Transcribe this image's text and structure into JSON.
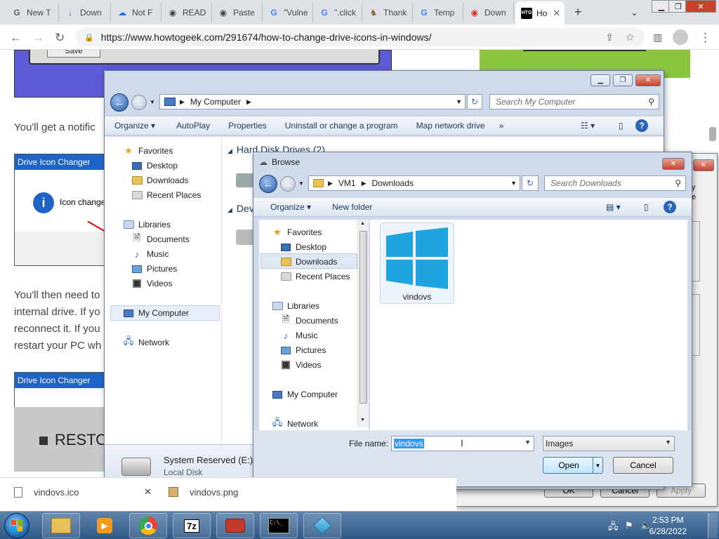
{
  "browser": {
    "tabs": [
      {
        "title": "New T",
        "icon": "G"
      },
      {
        "title": "Down",
        "icon": "↓"
      },
      {
        "title": "Not F",
        "icon": "☁"
      },
      {
        "title": "READ",
        "icon": "◉"
      },
      {
        "title": "Paste",
        "icon": "◉"
      },
      {
        "title": "\"Vulne",
        "icon": "G"
      },
      {
        "title": "\".click",
        "icon": "G"
      },
      {
        "title": "Thank",
        "icon": "♞"
      },
      {
        "title": "Temp",
        "icon": "G"
      },
      {
        "title": "Down",
        "icon": "◉"
      },
      {
        "title": "Ho",
        "icon": "HTG"
      }
    ],
    "new_tab_symbol": "+",
    "url": "https://www.howtogeek.com/291674/how-to-change-drive-icons-in-windows/"
  },
  "page": {
    "save_label": "Save",
    "para1": "You'll get a notific",
    "para2_lines": [
      "You'll then need to",
      "internal drive. If yo",
      "reconnect it. If you",
      "restart your PC wh"
    ],
    "dialog1_title": "Drive Icon Changer",
    "dialog1_text": "Icon change",
    "dialog2_title": "Drive Icon Changer",
    "restore_label": "RESTOR"
  },
  "explorer": {
    "location": "My Computer",
    "search_placeholder": "Search My Computer",
    "commands": [
      "Organize ▾",
      "AutoPlay",
      "Properties",
      "Uninstall or change a program",
      "Map network drive",
      "»"
    ],
    "nav": {
      "favorites": "Favorites",
      "desktop": "Desktop",
      "downloads": "Downloads",
      "recent": "Recent Places",
      "libraries": "Libraries",
      "documents": "Documents",
      "music": "Music",
      "pictures": "Pictures",
      "videos": "Videos",
      "computer": "My Computer",
      "network": "Network"
    },
    "group_hdd": "Hard Disk Drives (2)",
    "group_dev": "Dev",
    "status_name": "System Reserved (E:)",
    "status_type": "Local Disk"
  },
  "browse": {
    "title": "Browse",
    "path": [
      "VM1",
      "Downloads"
    ],
    "search_placeholder": "Search Downloads",
    "organize": "Organize ▾",
    "new_folder": "New folder",
    "nav": {
      "favorites": "Favorites",
      "desktop": "Desktop",
      "downloads": "Downloads",
      "recent": "Recent Places",
      "libraries": "Libraries",
      "documents": "Documents",
      "music": "Music",
      "pictures": "Pictures",
      "videos": "Videos",
      "computer": "My Computer",
      "network": "Network"
    },
    "file": "vindovs",
    "filename_label": "File name:",
    "filename_value": "vindovs",
    "filter": "Images",
    "open": "Open",
    "cancel": "Cancel"
  },
  "props": {
    "ok": "OK",
    "cancel": "Cancel",
    "apply": "Apply",
    "side_text_1": "y",
    "side_text_2": "e"
  },
  "downloads": [
    {
      "name": "vindovs.ico"
    },
    {
      "name": "vindovs.png"
    }
  ],
  "taskbar": {
    "time": "2:53 PM",
    "date": "6/28/2022",
    "cmd_label": "C:\\_"
  },
  "colors": {
    "accent": "#1f63c6",
    "page_purple": "#5b5bd6",
    "page_green": "#8cc63f",
    "selection": "#3399ff"
  }
}
